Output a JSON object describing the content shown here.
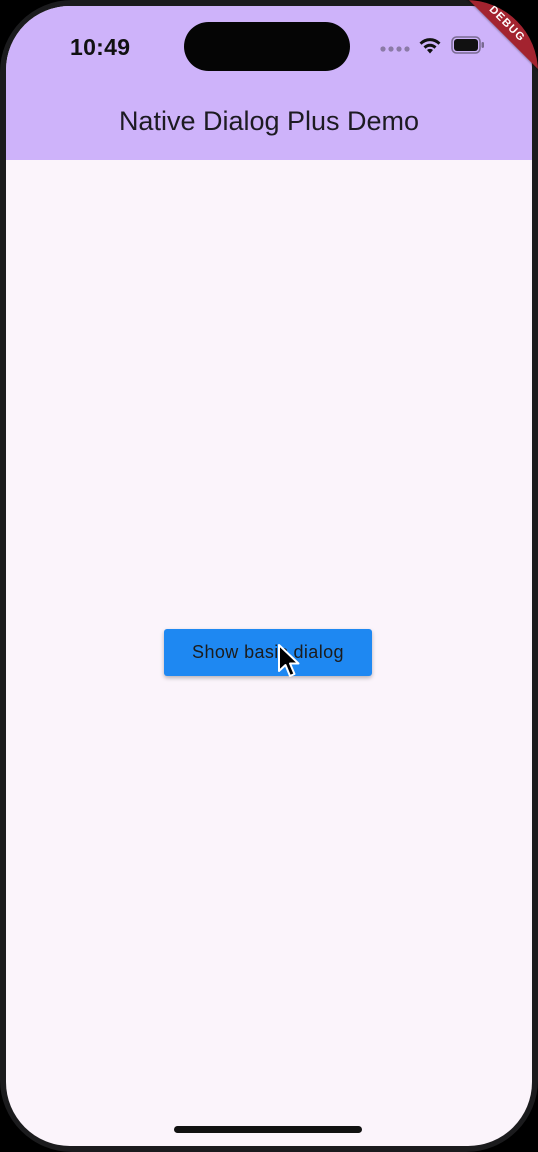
{
  "status_bar": {
    "time": "10:49",
    "icons": [
      "signal-dots-icon",
      "wifi-icon",
      "battery-icon"
    ]
  },
  "debug_banner": {
    "label": "DEBUG"
  },
  "app_bar": {
    "title": "Native Dialog Plus Demo",
    "background_color": "#ceb3fa"
  },
  "main": {
    "background_color": "#fbf4fb",
    "button": {
      "label": "Show basic dialog",
      "color": "#1e88f2"
    }
  },
  "cursor": {
    "icon": "mouse-pointer-icon"
  }
}
